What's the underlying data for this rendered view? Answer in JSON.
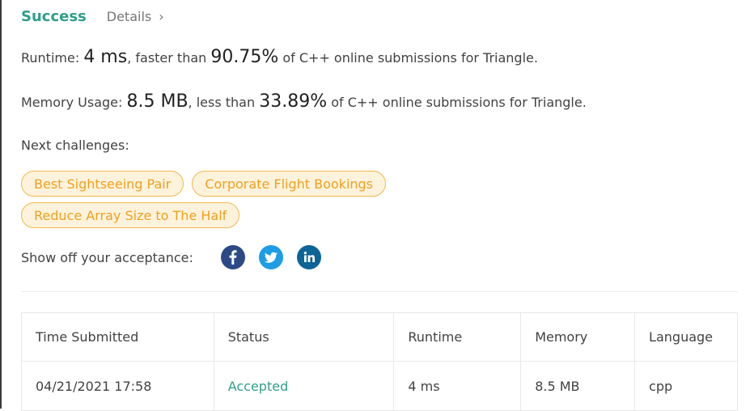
{
  "header": {
    "status_label": "Success",
    "details_label": "Details",
    "details_chevron": "›"
  },
  "runtime": {
    "label": "Runtime: ",
    "value": "4 ms",
    "comparison_prefix": ", faster than ",
    "percentile": "90.75%",
    "suffix": " of C++ online submissions for Triangle."
  },
  "memory": {
    "label": "Memory Usage: ",
    "value": "8.5 MB",
    "comparison_prefix": ", less than ",
    "percentile": "33.89%",
    "suffix": " of C++ online submissions for Triangle."
  },
  "next_challenges": {
    "label": "Next challenges:",
    "items": [
      {
        "label": "Best Sightseeing Pair"
      },
      {
        "label": "Corporate Flight Bookings"
      },
      {
        "label": "Reduce Array Size to The Half"
      }
    ]
  },
  "share": {
    "label": "Show off your acceptance:",
    "icons": [
      "facebook-icon",
      "twitter-icon",
      "linkedin-icon"
    ]
  },
  "submissions": {
    "columns": [
      "Time Submitted",
      "Status",
      "Runtime",
      "Memory",
      "Language"
    ],
    "rows": [
      {
        "time": "04/21/2021 17:58",
        "status": "Accepted",
        "runtime": "4 ms",
        "memory": "8.5 MB",
        "language": "cpp"
      }
    ]
  },
  "colors": {
    "success": "#2f9e8b",
    "chip_border": "#f2b84b",
    "chip_bg": "#fdf3dc",
    "chip_text": "#f0a020",
    "facebook": "#2c4a86",
    "twitter": "#1e9de6",
    "linkedin": "#0d6497"
  }
}
